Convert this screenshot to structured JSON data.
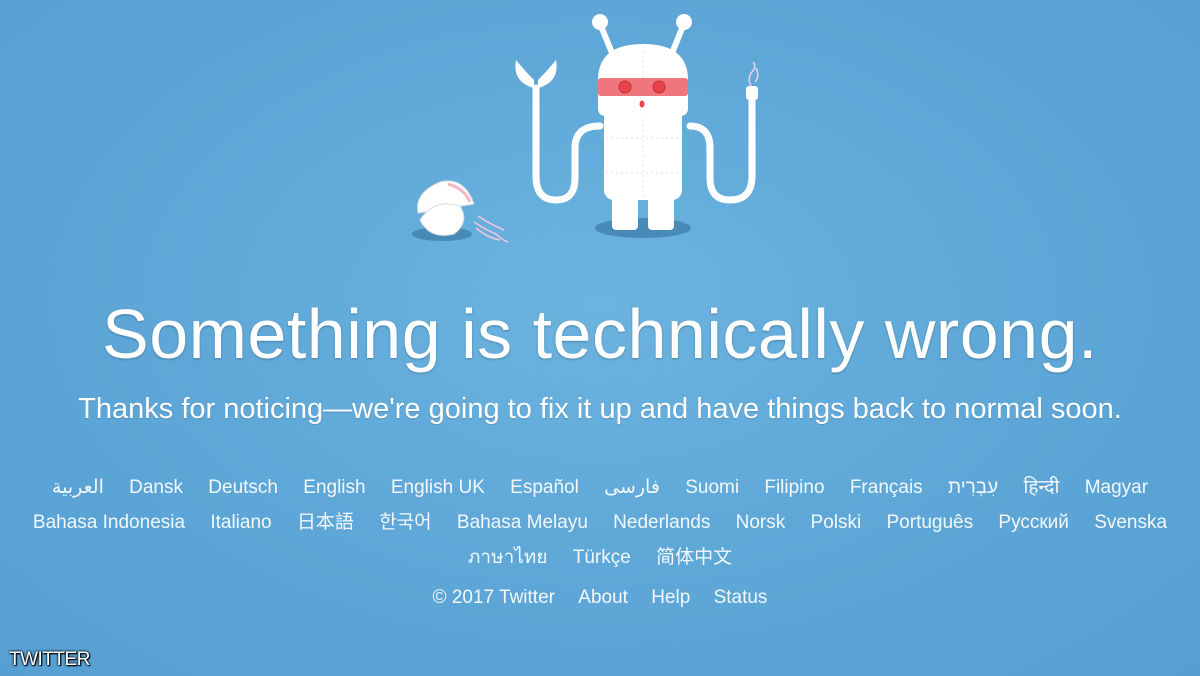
{
  "error": {
    "headline": "Something is technically wrong.",
    "subline": "Thanks for noticing—we're going to fix it up and have things back to normal soon.",
    "illustration": "broken-robot-illustration"
  },
  "languages": [
    "العربية",
    "Dansk",
    "Deutsch",
    "English",
    "English UK",
    "Español",
    "فارسی",
    "Suomi",
    "Filipino",
    "Français",
    "עִבְרִית",
    "हिन्दी",
    "Magyar",
    "Bahasa Indonesia",
    "Italiano",
    "日本語",
    "한국어",
    "Bahasa Melayu",
    "Nederlands",
    "Norsk",
    "Polski",
    "Português",
    "Русский",
    "Svenska",
    "ภาษาไทย",
    "Türkçe",
    "简体中文"
  ],
  "footer": {
    "copyright": "© 2017 Twitter",
    "about": "About",
    "help": "Help",
    "status": "Status"
  },
  "watermark": "TWITTER",
  "colors": {
    "background": "#5fa8d8",
    "text": "#ffffff",
    "robot_visor": "#f0767e",
    "robot_eyes": "#e8434b",
    "shadow": "#3f7fab"
  }
}
